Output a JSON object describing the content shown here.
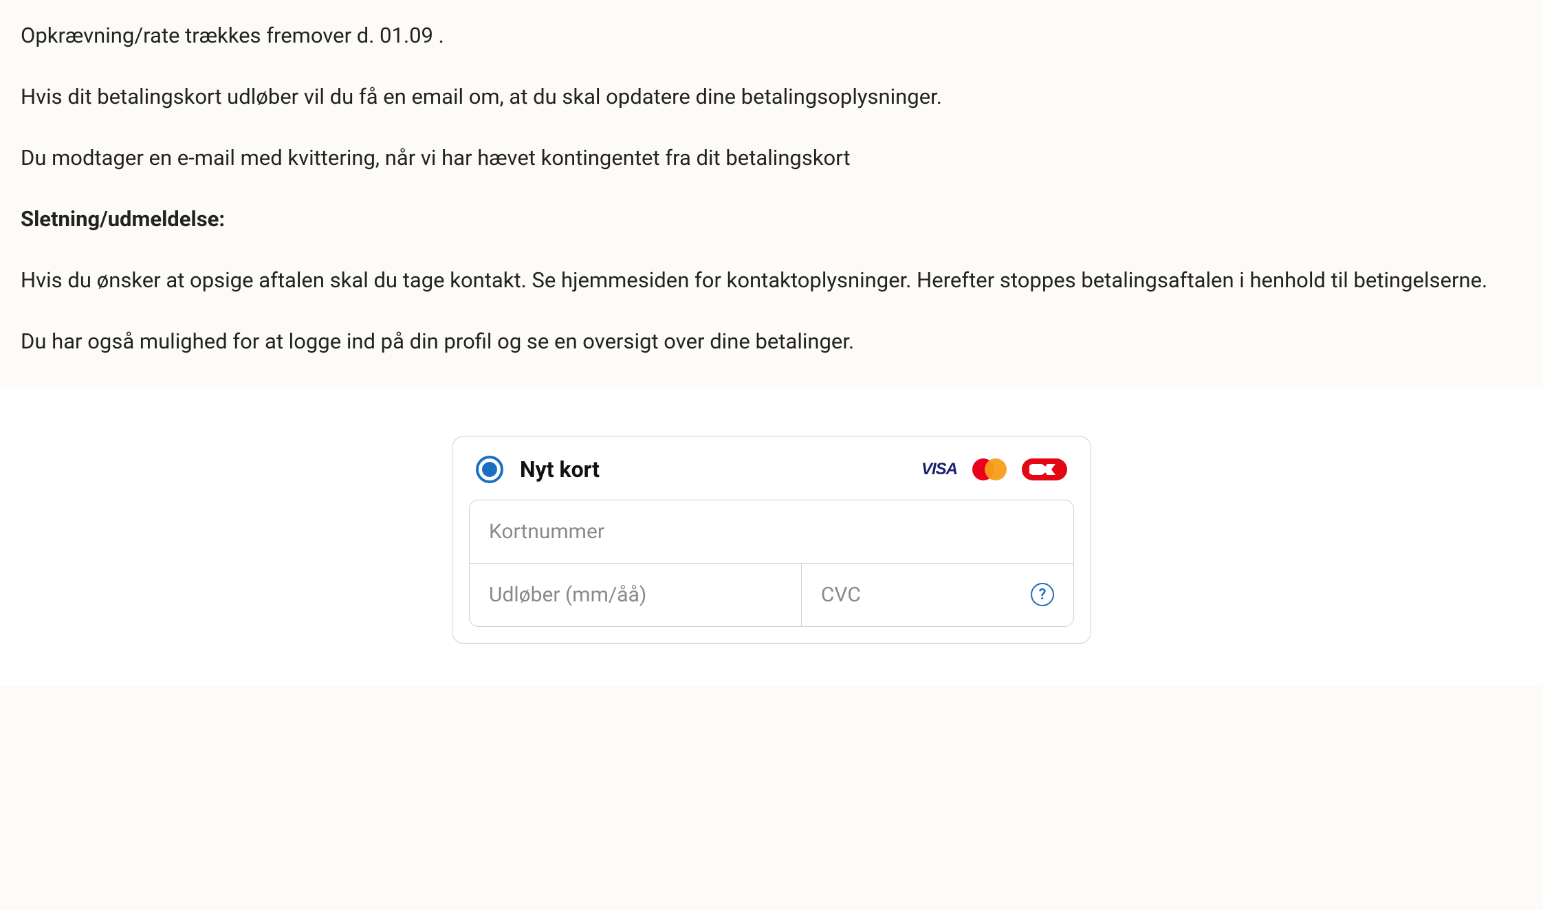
{
  "info": {
    "charge_line": "Opkrævning/rate trækkes fremover d. 01.09 .",
    "expiry_notice": "Hvis dit betalingskort udløber vil du få en email om, at du skal opdatere dine betalingsoplysninger.",
    "receipt_notice": "Du modtager en e-mail med kvittering, når vi har hævet kontingentet fra dit betalingskort",
    "cancel_heading": "Sletning/udmeldelse:",
    "cancel_body": "Hvis du ønsker at opsige aftalen skal du tage kontakt. Se hjemmesiden for kontaktoplysninger. Herefter stoppes betalingsaftalen i henhold til betingelserne.",
    "login_notice": "Du har også mulighed for at logge ind på din profil og se en oversigt over dine betalinger."
  },
  "card_form": {
    "title": "Nyt kort",
    "brands": {
      "visa": "VISA"
    },
    "card_number_placeholder": "Kortnummer",
    "expiry_placeholder": "Udløber (mm/åå)",
    "cvc_placeholder": "CVC",
    "help_symbol": "?"
  }
}
